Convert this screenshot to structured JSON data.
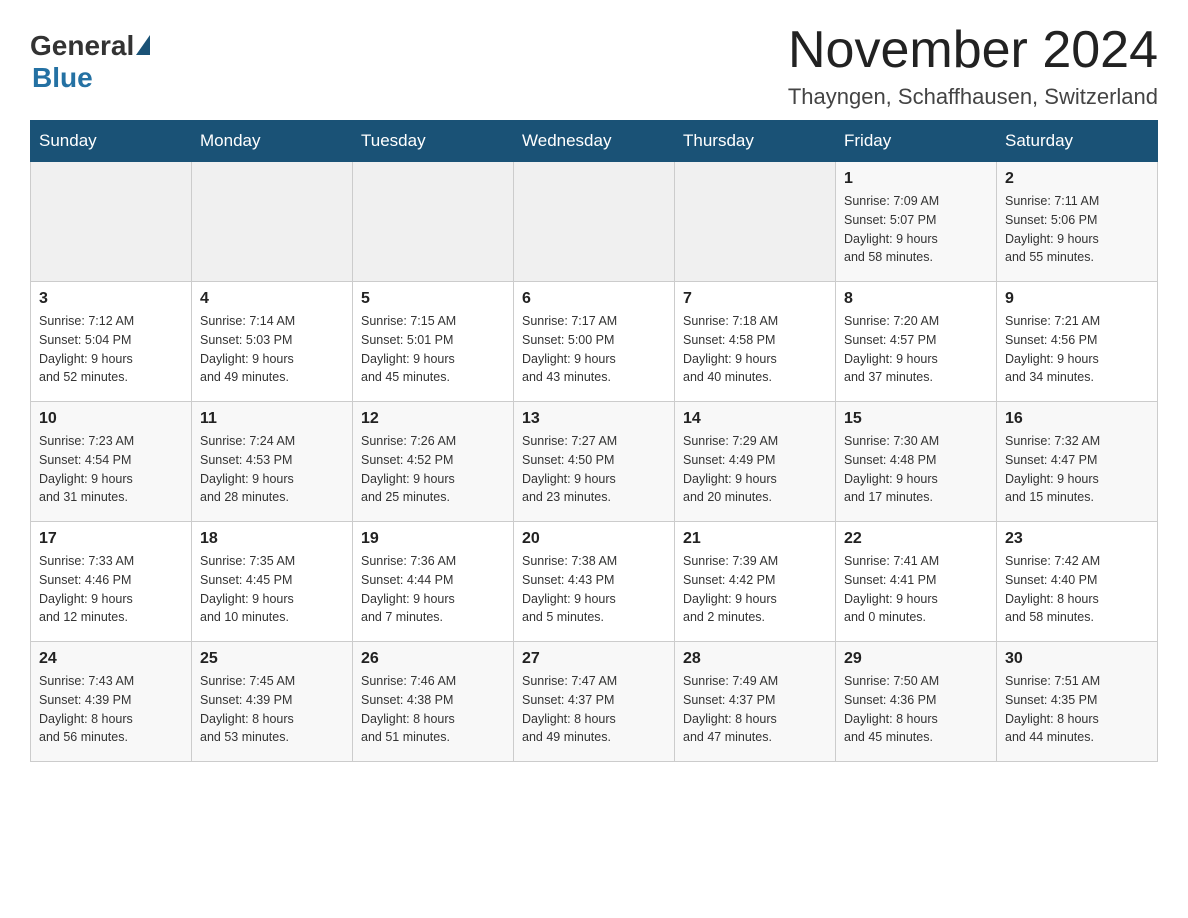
{
  "header": {
    "logo_general": "General",
    "logo_blue": "Blue",
    "month_title": "November 2024",
    "location": "Thayngen, Schaffhausen, Switzerland"
  },
  "weekdays": [
    "Sunday",
    "Monday",
    "Tuesday",
    "Wednesday",
    "Thursday",
    "Friday",
    "Saturday"
  ],
  "rows": [
    [
      {
        "day": "",
        "info": ""
      },
      {
        "day": "",
        "info": ""
      },
      {
        "day": "",
        "info": ""
      },
      {
        "day": "",
        "info": ""
      },
      {
        "day": "",
        "info": ""
      },
      {
        "day": "1",
        "info": "Sunrise: 7:09 AM\nSunset: 5:07 PM\nDaylight: 9 hours\nand 58 minutes."
      },
      {
        "day": "2",
        "info": "Sunrise: 7:11 AM\nSunset: 5:06 PM\nDaylight: 9 hours\nand 55 minutes."
      }
    ],
    [
      {
        "day": "3",
        "info": "Sunrise: 7:12 AM\nSunset: 5:04 PM\nDaylight: 9 hours\nand 52 minutes."
      },
      {
        "day": "4",
        "info": "Sunrise: 7:14 AM\nSunset: 5:03 PM\nDaylight: 9 hours\nand 49 minutes."
      },
      {
        "day": "5",
        "info": "Sunrise: 7:15 AM\nSunset: 5:01 PM\nDaylight: 9 hours\nand 45 minutes."
      },
      {
        "day": "6",
        "info": "Sunrise: 7:17 AM\nSunset: 5:00 PM\nDaylight: 9 hours\nand 43 minutes."
      },
      {
        "day": "7",
        "info": "Sunrise: 7:18 AM\nSunset: 4:58 PM\nDaylight: 9 hours\nand 40 minutes."
      },
      {
        "day": "8",
        "info": "Sunrise: 7:20 AM\nSunset: 4:57 PM\nDaylight: 9 hours\nand 37 minutes."
      },
      {
        "day": "9",
        "info": "Sunrise: 7:21 AM\nSunset: 4:56 PM\nDaylight: 9 hours\nand 34 minutes."
      }
    ],
    [
      {
        "day": "10",
        "info": "Sunrise: 7:23 AM\nSunset: 4:54 PM\nDaylight: 9 hours\nand 31 minutes."
      },
      {
        "day": "11",
        "info": "Sunrise: 7:24 AM\nSunset: 4:53 PM\nDaylight: 9 hours\nand 28 minutes."
      },
      {
        "day": "12",
        "info": "Sunrise: 7:26 AM\nSunset: 4:52 PM\nDaylight: 9 hours\nand 25 minutes."
      },
      {
        "day": "13",
        "info": "Sunrise: 7:27 AM\nSunset: 4:50 PM\nDaylight: 9 hours\nand 23 minutes."
      },
      {
        "day": "14",
        "info": "Sunrise: 7:29 AM\nSunset: 4:49 PM\nDaylight: 9 hours\nand 20 minutes."
      },
      {
        "day": "15",
        "info": "Sunrise: 7:30 AM\nSunset: 4:48 PM\nDaylight: 9 hours\nand 17 minutes."
      },
      {
        "day": "16",
        "info": "Sunrise: 7:32 AM\nSunset: 4:47 PM\nDaylight: 9 hours\nand 15 minutes."
      }
    ],
    [
      {
        "day": "17",
        "info": "Sunrise: 7:33 AM\nSunset: 4:46 PM\nDaylight: 9 hours\nand 12 minutes."
      },
      {
        "day": "18",
        "info": "Sunrise: 7:35 AM\nSunset: 4:45 PM\nDaylight: 9 hours\nand 10 minutes."
      },
      {
        "day": "19",
        "info": "Sunrise: 7:36 AM\nSunset: 4:44 PM\nDaylight: 9 hours\nand 7 minutes."
      },
      {
        "day": "20",
        "info": "Sunrise: 7:38 AM\nSunset: 4:43 PM\nDaylight: 9 hours\nand 5 minutes."
      },
      {
        "day": "21",
        "info": "Sunrise: 7:39 AM\nSunset: 4:42 PM\nDaylight: 9 hours\nand 2 minutes."
      },
      {
        "day": "22",
        "info": "Sunrise: 7:41 AM\nSunset: 4:41 PM\nDaylight: 9 hours\nand 0 minutes."
      },
      {
        "day": "23",
        "info": "Sunrise: 7:42 AM\nSunset: 4:40 PM\nDaylight: 8 hours\nand 58 minutes."
      }
    ],
    [
      {
        "day": "24",
        "info": "Sunrise: 7:43 AM\nSunset: 4:39 PM\nDaylight: 8 hours\nand 56 minutes."
      },
      {
        "day": "25",
        "info": "Sunrise: 7:45 AM\nSunset: 4:39 PM\nDaylight: 8 hours\nand 53 minutes."
      },
      {
        "day": "26",
        "info": "Sunrise: 7:46 AM\nSunset: 4:38 PM\nDaylight: 8 hours\nand 51 minutes."
      },
      {
        "day": "27",
        "info": "Sunrise: 7:47 AM\nSunset: 4:37 PM\nDaylight: 8 hours\nand 49 minutes."
      },
      {
        "day": "28",
        "info": "Sunrise: 7:49 AM\nSunset: 4:37 PM\nDaylight: 8 hours\nand 47 minutes."
      },
      {
        "day": "29",
        "info": "Sunrise: 7:50 AM\nSunset: 4:36 PM\nDaylight: 8 hours\nand 45 minutes."
      },
      {
        "day": "30",
        "info": "Sunrise: 7:51 AM\nSunset: 4:35 PM\nDaylight: 8 hours\nand 44 minutes."
      }
    ]
  ]
}
